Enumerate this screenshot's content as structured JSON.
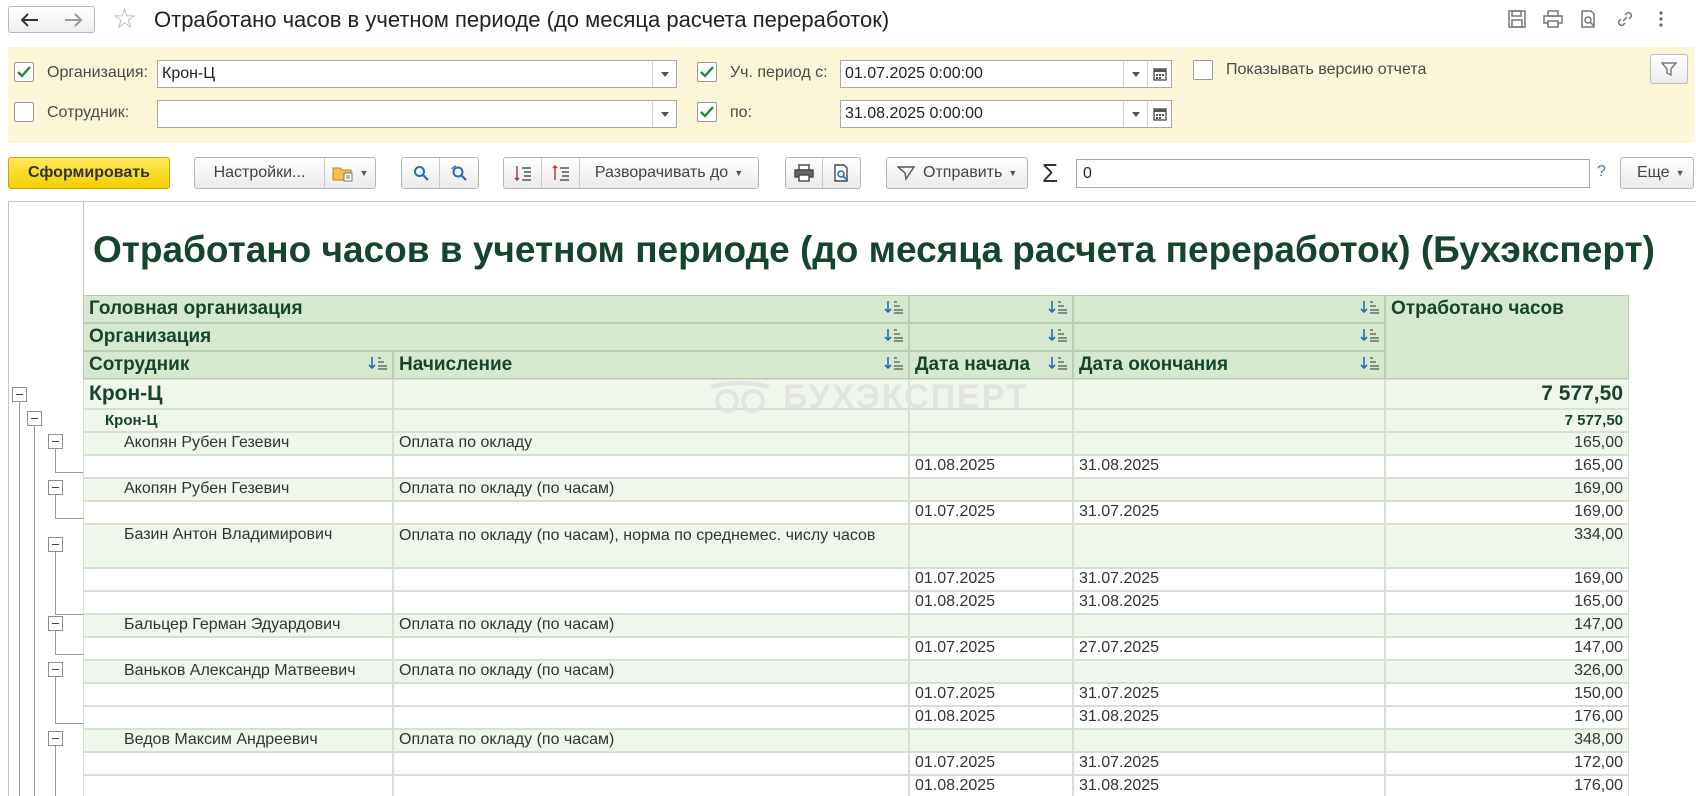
{
  "window": {
    "title": "Отработано часов в учетном периоде (до месяца расчета переработок)"
  },
  "filters": {
    "organization": {
      "label": "Организация:",
      "value": "Крон-Ц",
      "checked": true
    },
    "employee": {
      "label": "Сотрудник:",
      "value": "",
      "checked": false
    },
    "period_from": {
      "label": "Уч. период с:",
      "value": "01.07.2025  0:00:00",
      "checked": true
    },
    "period_to": {
      "label": "по:",
      "value": "31.08.2025  0:00:00",
      "checked": true
    },
    "show_version": {
      "label": "Показывать версию отчета",
      "checked": false
    }
  },
  "toolbar": {
    "generate": "Сформировать",
    "settings": "Настройки...",
    "expand_to": "Разворачивать до",
    "send": "Отправить",
    "sum_value": "0",
    "help": "?",
    "more": "Еще"
  },
  "report": {
    "title": "Отработано часов в учетном периоде (до месяца расчета переработок) (Бухэксперт)",
    "watermark": "БУХЭКСПЕРТ",
    "headers": {
      "head_org": "Головная организация",
      "org": "Организация",
      "employee": "Сотрудник",
      "accrual": "Начисление",
      "date_start": "Дата начала",
      "date_end": "Дата окончания",
      "hours": "Отработано часов"
    },
    "group1": {
      "name": "Крон-Ц",
      "hours": "7 577,50"
    },
    "group2": {
      "name": "Крон-Ц",
      "hours": "7 577,50"
    },
    "employees": [
      {
        "name": "Акопян Рубен Гезевич",
        "accrual": "Оплата по окладу",
        "hours": "165,00",
        "details": [
          {
            "start": "01.08.2025",
            "end": "31.08.2025",
            "hours": "165,00"
          }
        ]
      },
      {
        "name": "Акопян Рубен Гезевич",
        "accrual": "Оплата по окладу (по часам)",
        "hours": "169,00",
        "details": [
          {
            "start": "01.07.2025",
            "end": "31.07.2025",
            "hours": "169,00"
          }
        ]
      },
      {
        "name": "Базин Антон Владимирович",
        "accrual": "Оплата по окладу (по часам), норма по среднемес. числу часов",
        "hours": "334,00",
        "details": [
          {
            "start": "01.07.2025",
            "end": "31.07.2025",
            "hours": "169,00"
          },
          {
            "start": "01.08.2025",
            "end": "31.08.2025",
            "hours": "165,00"
          }
        ]
      },
      {
        "name": "Бальцер Герман Эдуардович",
        "accrual": "Оплата по окладу (по часам)",
        "hours": "147,00",
        "details": [
          {
            "start": "01.07.2025",
            "end": "27.07.2025",
            "hours": "147,00"
          }
        ]
      },
      {
        "name": "Ваньков Александр Матвеевич",
        "accrual": "Оплата по окладу (по часам)",
        "hours": "326,00",
        "details": [
          {
            "start": "01.07.2025",
            "end": "31.07.2025",
            "hours": "150,00"
          },
          {
            "start": "01.08.2025",
            "end": "31.08.2025",
            "hours": "176,00"
          }
        ]
      },
      {
        "name": "Ведов Максим Андреевич",
        "accrual": "Оплата по окладу (по часам)",
        "hours": "348,00",
        "details": [
          {
            "start": "01.07.2025",
            "end": "31.07.2025",
            "hours": "172,00"
          },
          {
            "start": "01.08.2025",
            "end": "31.08.2025",
            "hours": "176,00"
          }
        ]
      }
    ]
  }
}
